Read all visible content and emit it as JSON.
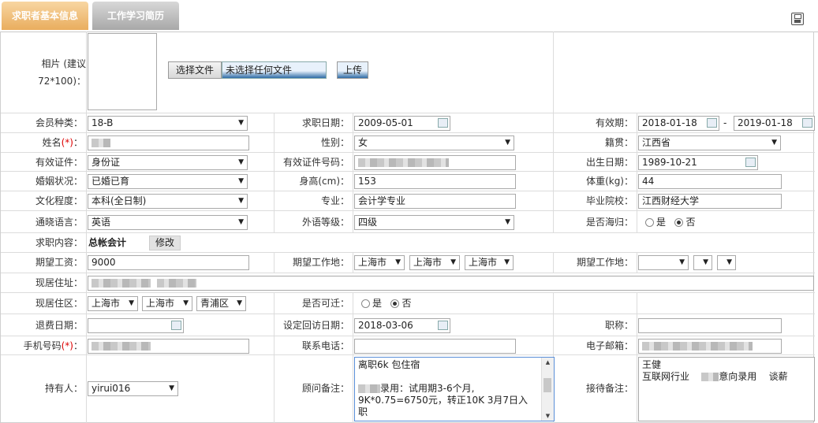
{
  "tabs": [
    "求职者基本信息",
    "工作学习简历"
  ],
  "photo": {
    "label": "相片 (建议72*100)：",
    "file_button": "选择文件",
    "file_status": "未选择任何文件",
    "upload_button": "上传"
  },
  "row_member": {
    "type_label": "会员种类：",
    "type_value": "18-B",
    "date_label": "求职日期：",
    "date_value": "2009-05-01",
    "valid_label": "有效期：",
    "valid_from": "2018-01-18",
    "valid_sep": "-",
    "valid_to": "2019-01-18"
  },
  "row_name": {
    "name_label": "姓名",
    "req_mark": "(*)",
    "colon": "：",
    "gender_label": "性别：",
    "gender_value": "女",
    "origin_label": "籍贯：",
    "origin_value": "江西省"
  },
  "row_id": {
    "cert_label": "有效证件：",
    "cert_value": "身份证",
    "cert_no_label": "有效证件号码：",
    "birth_label": "出生日期：",
    "birth_value": "1989-10-21"
  },
  "row_marry": {
    "label": "婚姻状况：",
    "value": "已婚已育",
    "height_label": "身高(cm)：",
    "height_value": "153",
    "weight_label": "体重(kg)：",
    "weight_value": "44"
  },
  "row_edu": {
    "label": "文化程度：",
    "value": "本科(全日制)",
    "major_label": "专业：",
    "major_value": "会计学专业",
    "school_label": "毕业院校：",
    "school_value": "江西财经大学"
  },
  "row_lang": {
    "label": "通晓语言：",
    "value": "英语",
    "level_label": "外语等级：",
    "level_value": "四级",
    "abroad_label": "是否海归：",
    "yes": "是",
    "no": "否"
  },
  "row_job": {
    "label": "求职内容：",
    "value": "总帐会计",
    "edit_button": "修改"
  },
  "row_salary": {
    "label": "期望工资：",
    "value": "9000",
    "place_label": "期望工作地：",
    "p1": "上海市",
    "p2": "上海市",
    "p3": "上海市",
    "place2_label": "期望工作地："
  },
  "row_addr": {
    "label": "现居住址："
  },
  "row_area": {
    "label": "现居住区：",
    "a1": "上海市",
    "a2": "上海市",
    "a3": "青浦区",
    "move_label": "是否可迁：",
    "yes": "是",
    "no": "否"
  },
  "row_refund": {
    "label": "退费日期：",
    "visit_label": "设定回访日期：",
    "visit_value": "2018-03-06",
    "title_label": "职称："
  },
  "row_phone": {
    "mobile_label": "手机号码",
    "req_mark": "(*)",
    "colon": "：",
    "tel_label": "联系电话：",
    "email_label": "电子邮箱："
  },
  "row_owner": {
    "label": "持有人：",
    "value": "yirui016",
    "advisor_label": "顾问备注：",
    "advisor_note_1": "离职6k 包住宿",
    "advisor_note_2": "录用：试用期3-6个月,",
    "advisor_note_3": "9K*0.75=6750元，转正10K 3月7日入",
    "advisor_note_4": "职",
    "reception_label": "接待备注：",
    "reception_note_1": "王健",
    "reception_note_2": "互联网行业",
    "reception_note_3": "意向录用",
    "reception_note_4": "谈薪"
  }
}
